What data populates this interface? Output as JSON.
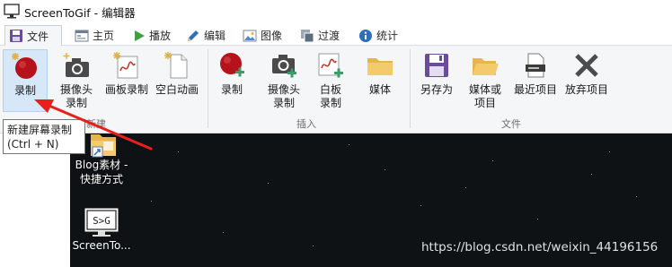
{
  "window": {
    "title": "ScreenToGif - 编辑器",
    "title_icon": "monitor-icon"
  },
  "tabs": [
    {
      "label": "文件",
      "icon": "save-icon",
      "active": true
    },
    {
      "label": "主页",
      "icon": "home-icon",
      "active": false
    },
    {
      "label": "播放",
      "icon": "play-icon",
      "active": false
    },
    {
      "label": "编辑",
      "icon": "pencil-icon",
      "active": false
    },
    {
      "label": "图像",
      "icon": "image-icon",
      "active": false
    },
    {
      "label": "过渡",
      "icon": "transition-icon",
      "active": false
    },
    {
      "label": "统计",
      "icon": "info-icon",
      "active": false
    }
  ],
  "ribbon": {
    "groups": [
      {
        "label": "新建",
        "buttons": [
          {
            "label": "录制",
            "icon": "record-new-icon"
          },
          {
            "label": "摄像头\n录制",
            "icon": "webcam-new-icon"
          },
          {
            "label": "画板录制",
            "icon": "board-new-icon"
          },
          {
            "label": "空白动画",
            "icon": "blank-doc-icon"
          }
        ]
      },
      {
        "label": "插入",
        "buttons": [
          {
            "label": "录制",
            "icon": "record-add-icon"
          },
          {
            "label": "摄像头\n录制",
            "icon": "webcam-add-icon"
          },
          {
            "label": "白板\n录制",
            "icon": "board-add-icon"
          },
          {
            "label": "媒体",
            "icon": "folder-icon"
          }
        ]
      },
      {
        "label": "文件",
        "buttons": [
          {
            "label": "另存为",
            "icon": "floppy-icon"
          },
          {
            "label": "媒体或\n项目",
            "icon": "folder-open-icon"
          },
          {
            "label": "最近项目",
            "icon": "recent-file-icon"
          },
          {
            "label": "放弃项目",
            "icon": "discard-icon"
          }
        ]
      }
    ]
  },
  "tooltip": {
    "text": "新建屏幕录制\n(Ctrl + N)"
  },
  "desktop": {
    "icons": [
      {
        "label": "Blog素材 -\n快捷方式",
        "icon": "folder-shortcut-icon"
      },
      {
        "label": "ScreenTo...",
        "icon": "screentogif-app-icon",
        "logo_text": "S>G"
      }
    ]
  },
  "watermark": "https://blog.csdn.net/weixin_44196156",
  "colors": {
    "record_red": "#b5121b",
    "accent_blue": "#2b6cb0",
    "annotation_red": "#e8201c",
    "desktop_bg": "#0f1215"
  }
}
